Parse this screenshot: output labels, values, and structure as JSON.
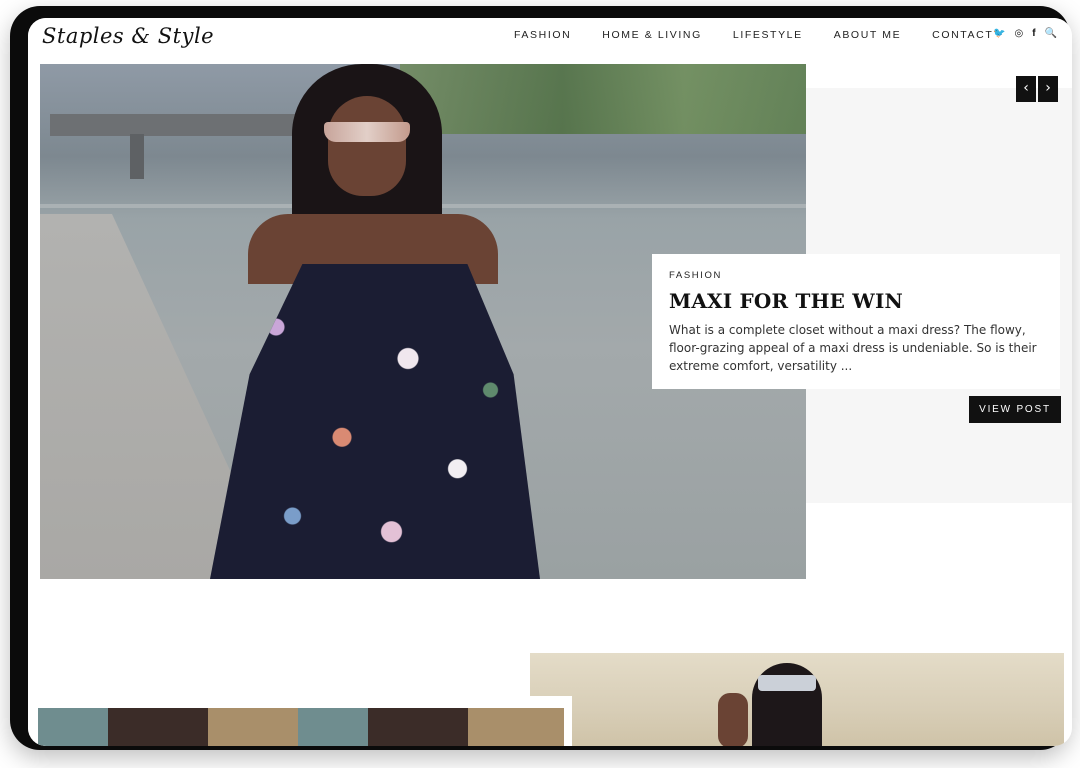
{
  "brand": {
    "logo_text": "Staples & Style"
  },
  "nav": {
    "items": [
      {
        "label": "FASHION"
      },
      {
        "label": "HOME & LIVING"
      },
      {
        "label": "LIFESTYLE"
      },
      {
        "label": "ABOUT ME"
      },
      {
        "label": "CONTACT"
      }
    ]
  },
  "social": {
    "twitter_glyph": "🐦",
    "instagram_glyph": "◎",
    "facebook_glyph": "f",
    "search_glyph": "🔍"
  },
  "slider": {
    "prev_glyph": "‹",
    "next_glyph": "›"
  },
  "featured_post": {
    "category": "FASHION",
    "title": "MAXI FOR THE WIN",
    "excerpt": "What is a complete closet without a maxi dress? The flowy, floor-grazing appeal of a maxi dress is undeniable. So is their extreme comfort, versatility ...",
    "button_label": "VIEW POST"
  }
}
